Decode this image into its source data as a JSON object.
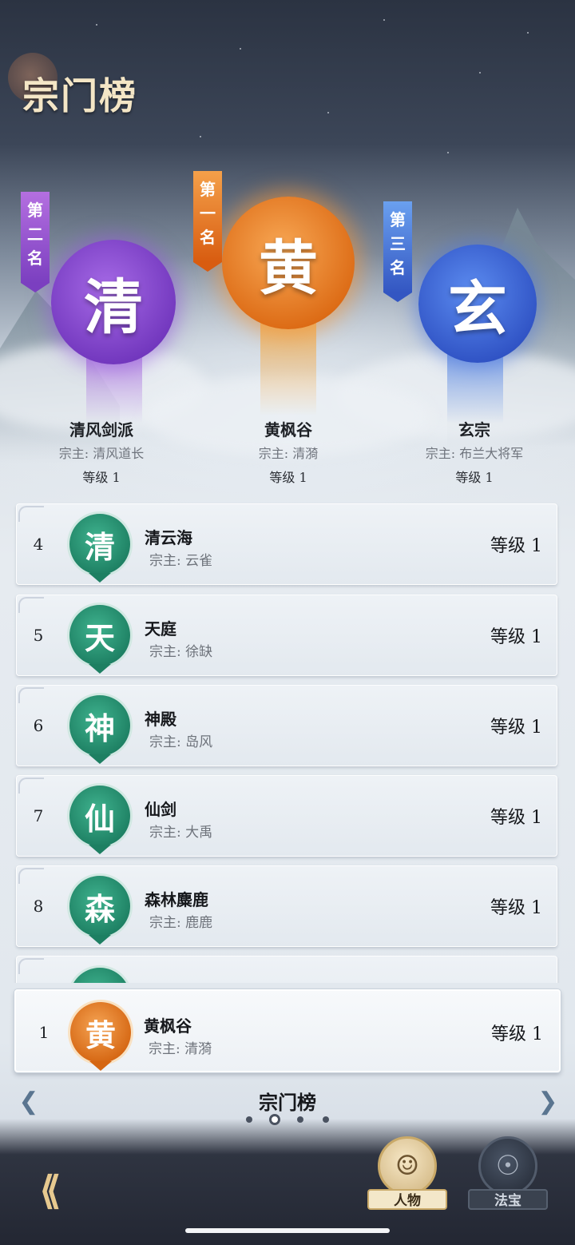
{
  "page": {
    "title": "宗门榜"
  },
  "podium": [
    {
      "rank_label": "第一名",
      "emblem": "黄",
      "name": "黄枫谷",
      "leader": "宗主: 清漪",
      "level": "等级 1",
      "color": "#e2741e"
    },
    {
      "rank_label": "第二名",
      "emblem": "清",
      "name": "清风剑派",
      "leader": "宗主: 清风道长",
      "level": "等级 1",
      "color": "#8a4fcf"
    },
    {
      "rank_label": "第三名",
      "emblem": "玄",
      "name": "玄宗",
      "leader": "宗主: 布兰大将军",
      "level": "等级 1",
      "color": "#3d67d4"
    }
  ],
  "podium_chars": {
    "first": [
      "第",
      "一",
      "名"
    ],
    "second": [
      "第",
      "二",
      "名"
    ],
    "third": [
      "第",
      "三",
      "名"
    ]
  },
  "ranking_list": [
    {
      "rank": "4",
      "emblem": "清",
      "name": "清云海",
      "leader": "宗主: 云雀",
      "level": "等级 1"
    },
    {
      "rank": "5",
      "emblem": "天",
      "name": "天庭",
      "leader": "宗主: 徐缺",
      "level": "等级 1"
    },
    {
      "rank": "6",
      "emblem": "神",
      "name": "神殿",
      "leader": "宗主: 岛风",
      "level": "等级 1"
    },
    {
      "rank": "7",
      "emblem": "仙",
      "name": "仙剑",
      "leader": "宗主: 大禹",
      "level": "等级 1"
    },
    {
      "rank": "8",
      "emblem": "森",
      "name": "森林麋鹿",
      "leader": "宗主: 鹿鹿",
      "level": "等级 1"
    }
  ],
  "my_sect": {
    "rank": "1",
    "emblem": "黄",
    "name": "黄枫谷",
    "leader": "宗主: 清漪",
    "level": "等级 1"
  },
  "pager": {
    "title": "宗门榜",
    "page_count": 4,
    "active_index": 1,
    "prev_icon": "chevron-left-icon",
    "next_icon": "chevron-right-icon"
  },
  "bottom_nav": {
    "back_icon": "back-arrow-icon",
    "items": [
      {
        "label": "人物",
        "icon": "character-icon",
        "active": true
      },
      {
        "label": "法宝",
        "icon": "gourd-icon",
        "active": false
      }
    ]
  }
}
